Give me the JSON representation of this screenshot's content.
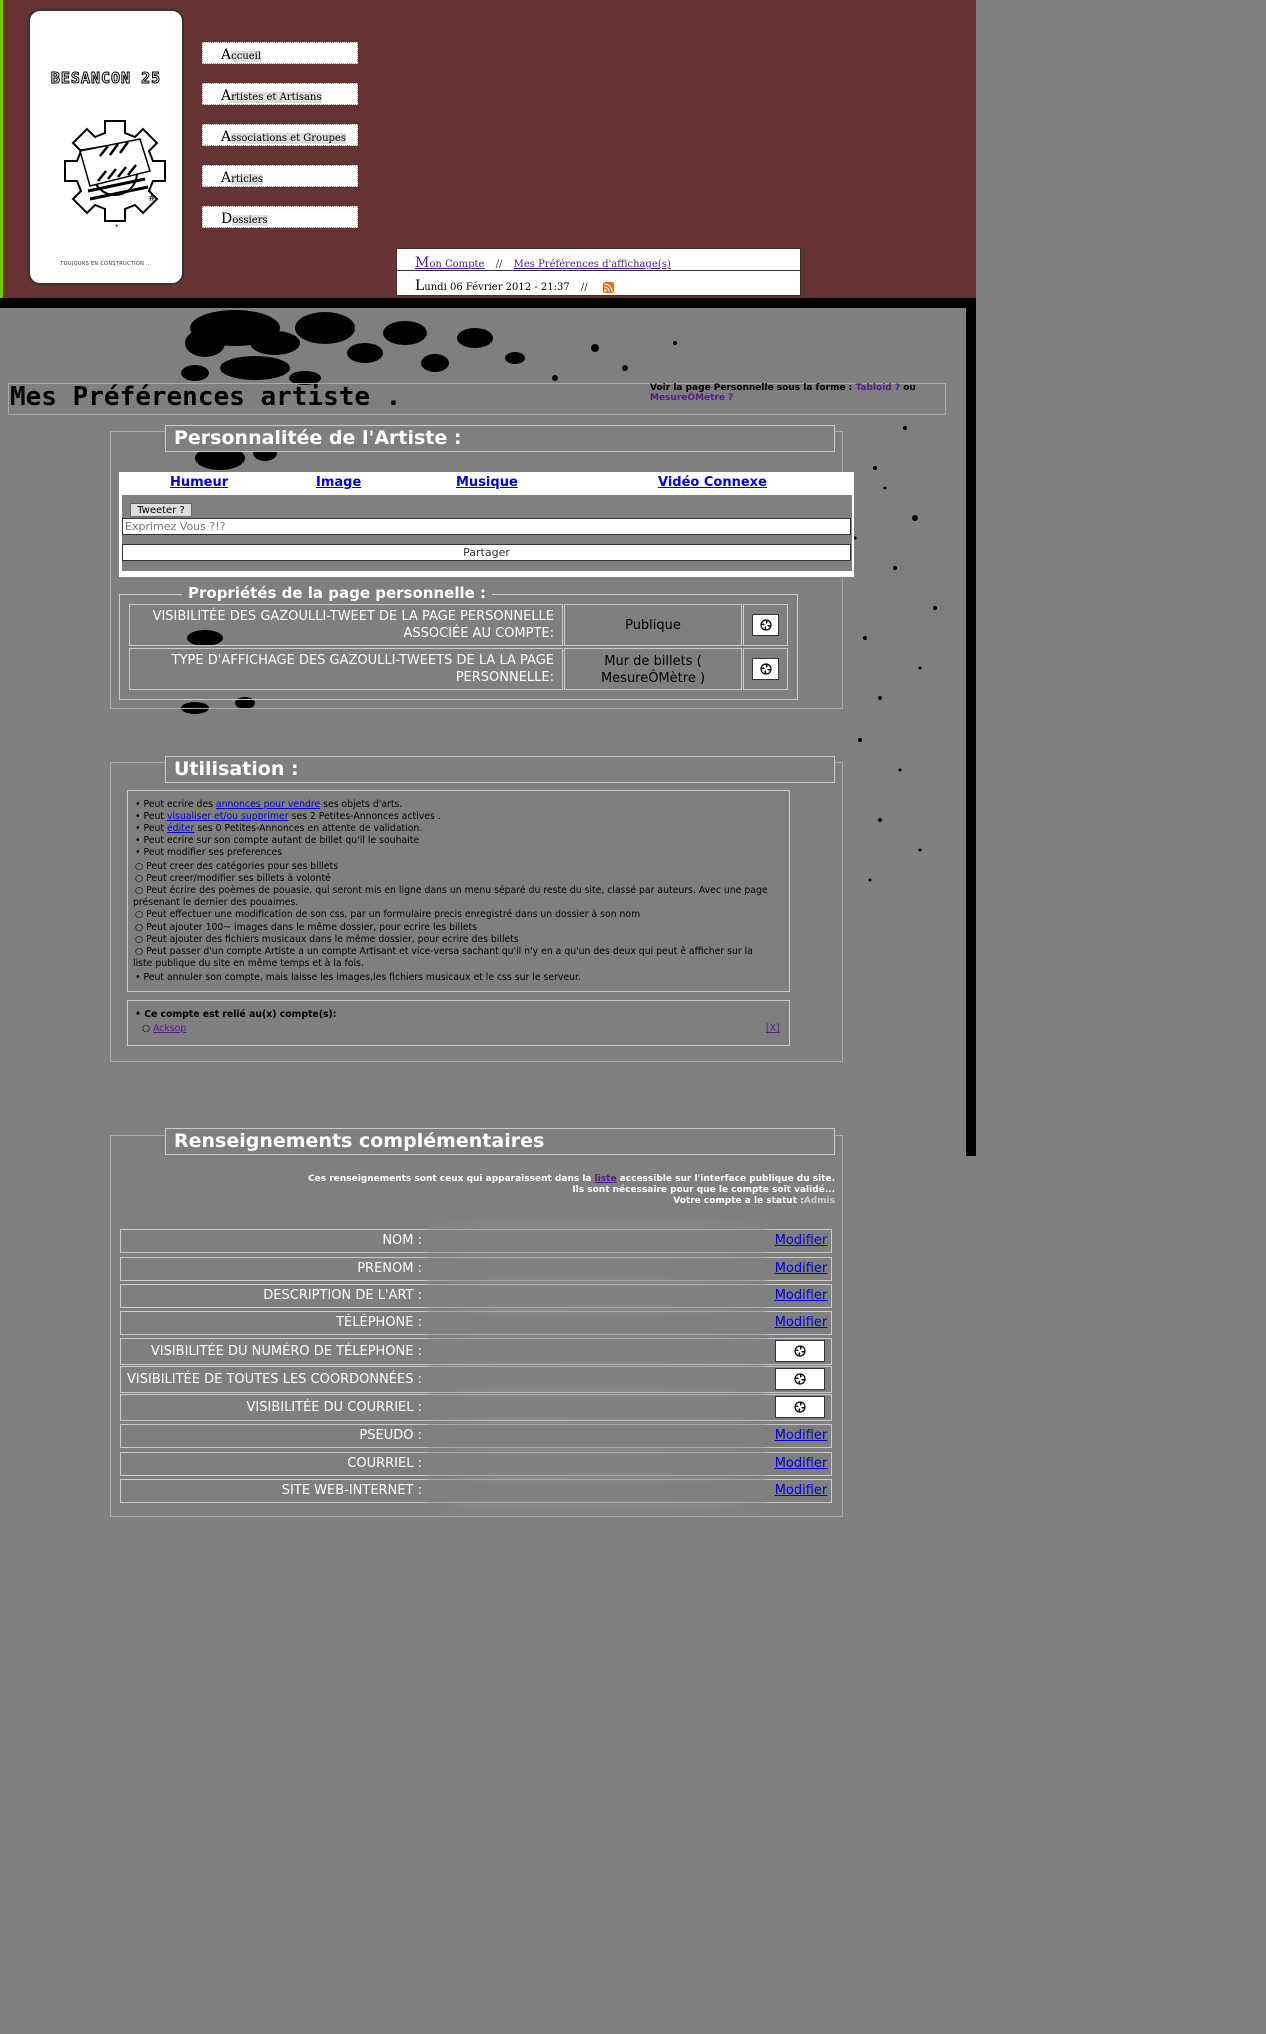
{
  "logo": {
    "title": "BESANCON 25",
    "caption": "TOUJOURS EN CONSTRUCTION ..."
  },
  "nav": [
    {
      "cap": "A",
      "rest": "ccueil"
    },
    {
      "cap": "A",
      "rest": "rtistes et Artisans"
    },
    {
      "cap": "A",
      "rest": "ssociations et Groupes"
    },
    {
      "cap": "A",
      "rest": "rticles"
    },
    {
      "cap": "D",
      "rest": "ossiers"
    }
  ],
  "account": {
    "my_account_cap": "M",
    "my_account_rest": "on Compte",
    "separator": "//",
    "prefs_link": "Mes Préférences d'affichage(s)",
    "date_cap": "L",
    "date_rest": "undi 06 Février 2012 - 21:37",
    "rss_icon": "rss-icon"
  },
  "page": {
    "title": "Mes Préférences artiste .",
    "view_as_prefix": "Voir la page Personnelle sous la forme :",
    "view_as_opt1": "Tabloid ?",
    "view_as_or": "ou",
    "view_as_opt2": "MesureÔMètre ?"
  },
  "personality": {
    "legend": "Personnalitée de l'Artiste :",
    "tabs": [
      "Humeur",
      "Image",
      "Musique",
      "Vidéo Connexe"
    ],
    "tweet_button": "Tweeter ?",
    "input_placeholder": "Exprimez Vous ?!?",
    "share_button": "Partager",
    "props_legend": "Propriétés de la page personnelle :",
    "props": [
      {
        "label": "VISIBILITÉE DES GAZOULLI-TWEET DE LA PAGE PERSONNELLE ASSOCIÉE AU COMPTE:",
        "value": "Publique",
        "icon": "refresh-icon"
      },
      {
        "label": "TYPE D'AFFICHAGE DES GAZOULLI-TWEETS DE LA LA PAGE PERSONNELLE:",
        "value": "Mur de billets ( MesureÔMètre )",
        "icon": "refresh-icon"
      }
    ]
  },
  "usage": {
    "legend": "Utilisation :",
    "items": {
      "i1_pre": "Peut ecrire des ",
      "i1_link": "annonces pour vendre",
      "i1_post": " ses objets d'arts.",
      "i2_pre": "Peut ",
      "i2_link": "visualiser et/ou supprimer",
      "i2_post": " ses 2 Petites-Annonces actives .",
      "i3_pre": "Peut ",
      "i3_link": "éditer",
      "i3_post": " ses 0 Petites-Annonces en attente de validation.",
      "i4": "Peut ecrire sur son compte autant de billet qu'il le souhaite",
      "i5": "Peut modifier ses preferences",
      "s1": "Peut creer des catégories pour ses billets",
      "s2": "Peut creer/modifier ses billets à volonté",
      "s3a": "Peut écrire des poèmes de pouasie, qui seront mis en ligne dans un menu séparé du reste du site, classé par auteurs. Avec une page",
      "s3b": "présenant le dernier des pouaimes.",
      "s4": "Peut effectuer une modification de son css, par un formulaire precis enregistré dans un dossier à son nom",
      "s5": "Peut ajouter 100~ images dans le même dossier, pour ecrire les billets",
      "s6": "Peut ajouter des fichiers musicaux dans le même dossier, pour ecrire des billets",
      "s7a": "Peut passer d'un compte Artiste a un compte Artisant et vice-versa sachant qu'il n'y en a qu'un des deux qui peut ê afficher sur la",
      "s7b": "liste publique du site en même temps et à la fois.",
      "i6": "Peut annuler son compte, mais laisse les images,les fichiers musicaux et le css sur le serveur."
    },
    "linked_title": "Ce compte est relié au(x) compte(s):",
    "linked_account": "Acksop",
    "linked_remove": "[X]"
  },
  "info": {
    "legend": "Renseignements complémentaires",
    "note1_pre": "Ces renseignements sont ceux qui apparaissent dans la ",
    "note1_link": "liste",
    "note1_post": " accessible sur l'interface publique du site.",
    "note2": "Ils sont nécessaire pour que le compte soit validé...",
    "note3_pre": "Votre compte a le statut :",
    "note3_status": "Admis",
    "modify_label": "Modifier",
    "rows": [
      {
        "label": "NOM :",
        "action": "modify"
      },
      {
        "label": "PRENOM :",
        "action": "modify"
      },
      {
        "label": "DESCRIPTION DE L'ART :",
        "action": "modify"
      },
      {
        "label": "TÉLÉPHONE :",
        "action": "modify"
      },
      {
        "label": "VISIBILITÉE DU NUMÉRO DE TÉLEPHONE :",
        "action": "icon"
      },
      {
        "label": "VISIBILITÉE DE TOUTES LES COORDONNÉES :",
        "action": "icon"
      },
      {
        "label": "VISIBILITÉE DU COURRIEL :",
        "action": "icon"
      },
      {
        "label": "PSEUDO :",
        "action": "modify"
      },
      {
        "label": "COURRIEL :",
        "action": "modify"
      },
      {
        "label": "SITE WEB-INTERNET :",
        "action": "modify"
      }
    ]
  },
  "colors": {
    "header_bg": "#663333",
    "page_bg": "#7f7f7f",
    "link": "#0000cc",
    "visited": "#551a8b"
  }
}
